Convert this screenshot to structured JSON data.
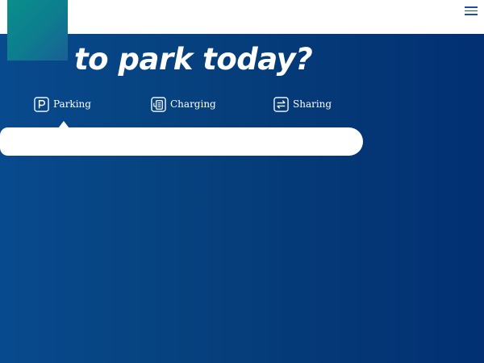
{
  "header": {
    "menu_icon": "hamburger-menu-icon"
  },
  "hero": {
    "headline": "to park today?"
  },
  "tabs": [
    {
      "label": "Parking",
      "icon": "parking-icon"
    },
    {
      "label": "Charging",
      "icon": "charging-icon"
    },
    {
      "label": "Sharing",
      "icon": "sharing-icon"
    }
  ],
  "search": {
    "value": "",
    "placeholder": ""
  },
  "colors": {
    "brand_blue": "#06427f",
    "teal_accent": "#0a8f8a",
    "white": "#ffffff"
  }
}
